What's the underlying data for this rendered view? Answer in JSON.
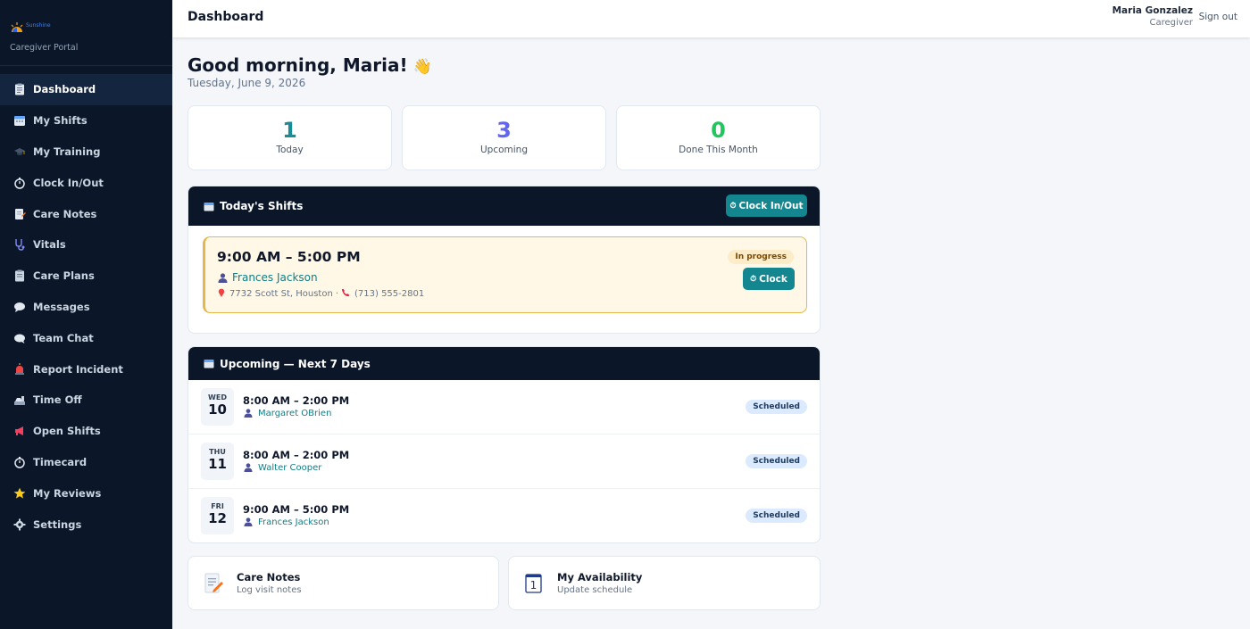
{
  "brand": {
    "logo_text": "Sunshine",
    "portal_label": "Caregiver Portal"
  },
  "nav": [
    {
      "label": "Dashboard",
      "icon": "clipboard-icon",
      "active": true
    },
    {
      "label": "My Shifts",
      "icon": "calendar-icon"
    },
    {
      "label": "My Training",
      "icon": "graduation-cap-icon"
    },
    {
      "label": "Clock In/Out",
      "icon": "stopwatch-icon"
    },
    {
      "label": "Care Notes",
      "icon": "note-icon"
    },
    {
      "label": "Vitals",
      "icon": "stethoscope-icon"
    },
    {
      "label": "Care Plans",
      "icon": "clipboard-icon"
    },
    {
      "label": "Messages",
      "icon": "speech-bubble-icon"
    },
    {
      "label": "Team Chat",
      "icon": "chat-bubble-icon"
    },
    {
      "label": "Report Incident",
      "icon": "siren-icon"
    },
    {
      "label": "Time Off",
      "icon": "beach-icon"
    },
    {
      "label": "Open Shifts",
      "icon": "megaphone-icon"
    },
    {
      "label": "Timecard",
      "icon": "stopwatch-icon"
    },
    {
      "label": "My Reviews",
      "icon": "star-icon"
    },
    {
      "label": "Settings",
      "icon": "gear-icon"
    }
  ],
  "header": {
    "title": "Dashboard",
    "user_name": "Maria Gonzalez",
    "user_role": "Caregiver",
    "signout_label": "Sign out"
  },
  "greeting": {
    "text": "Good morning, Maria!",
    "emoji": "👋",
    "date": "Tuesday, June 9, 2026"
  },
  "stats": [
    {
      "value": "1",
      "label": "Today",
      "color": "#1a8c95"
    },
    {
      "value": "3",
      "label": "Upcoming",
      "color": "#6366f1"
    },
    {
      "value": "0",
      "label": "Done This Month",
      "color": "#22c55e"
    }
  ],
  "today": {
    "title": "Today's Shifts",
    "clock_button": "Clock In/Out",
    "shift": {
      "time": "9:00 AM – 5:00 PM",
      "client": "Frances Jackson",
      "address": "7732 Scott St, Houston",
      "separator": "·",
      "phone": "(713) 555-2801",
      "status": "In progress",
      "clock_label": "Clock"
    }
  },
  "upcoming": {
    "title": "Upcoming — Next 7 Days",
    "items": [
      {
        "dow": "WED",
        "day": "10",
        "time": "8:00 AM – 2:00 PM",
        "client": "Margaret OBrien",
        "status": "Scheduled"
      },
      {
        "dow": "THU",
        "day": "11",
        "time": "8:00 AM – 2:00 PM",
        "client": "Walter Cooper",
        "status": "Scheduled"
      },
      {
        "dow": "FRI",
        "day": "12",
        "time": "9:00 AM – 5:00 PM",
        "client": "Frances Jackson",
        "status": "Scheduled"
      }
    ]
  },
  "quick_links": [
    {
      "title": "Care Notes",
      "subtitle": "Log visit notes",
      "icon": "memo-icon"
    },
    {
      "title": "My Availability",
      "subtitle": "Update schedule",
      "icon": "calendar-one-icon"
    }
  ],
  "colors": {
    "sidebar_bg": "#0b1729",
    "teal": "#14868f",
    "header_dark": "#0b1729"
  }
}
